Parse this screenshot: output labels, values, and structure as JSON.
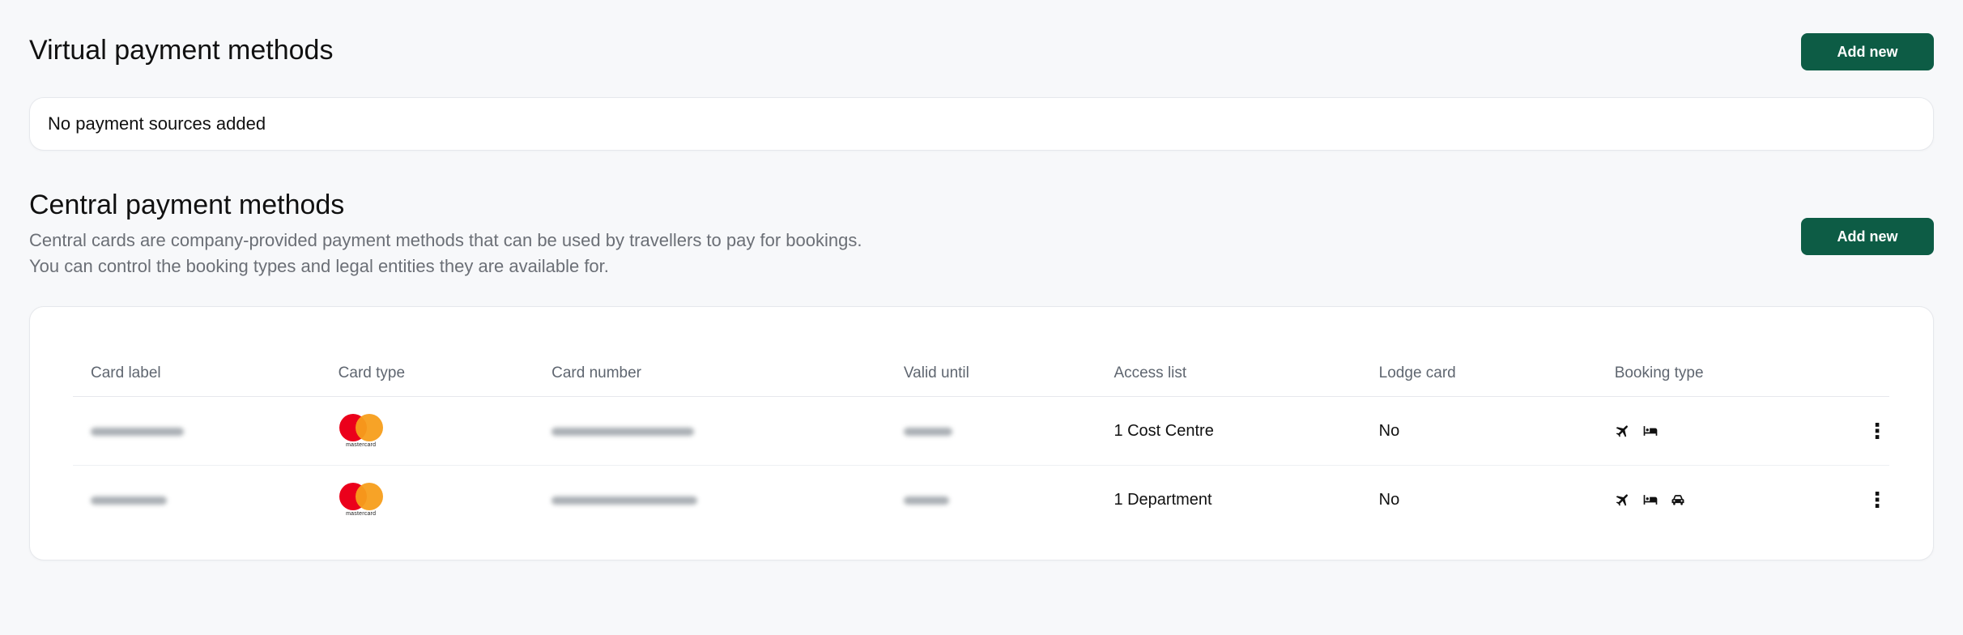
{
  "virtual": {
    "title": "Virtual payment methods",
    "add_label": "Add new",
    "empty_text": "No payment sources added"
  },
  "central": {
    "title": "Central payment methods",
    "add_label": "Add new",
    "description_line1": "Central cards are company-provided payment methods that can be used by travellers to pay for bookings.",
    "description_line2": "You can control the booking types and legal entities they are available for.",
    "columns": [
      "Card label",
      "Card type",
      "Card number",
      "Valid until",
      "Access list",
      "Lodge card",
      "Booking type"
    ],
    "rows": [
      {
        "card_type": "mastercard",
        "access_list": "1 Cost Centre",
        "lodge_card": "No",
        "booking_icons": [
          "plane-icon",
          "bed-icon"
        ]
      },
      {
        "card_type": "mastercard",
        "access_list": "1 Department",
        "lodge_card": "No",
        "booking_icons": [
          "plane-icon",
          "bed-icon",
          "car-icon"
        ]
      }
    ]
  },
  "colors": {
    "accent": "#0d5c45",
    "background": "#f7f8fa"
  }
}
